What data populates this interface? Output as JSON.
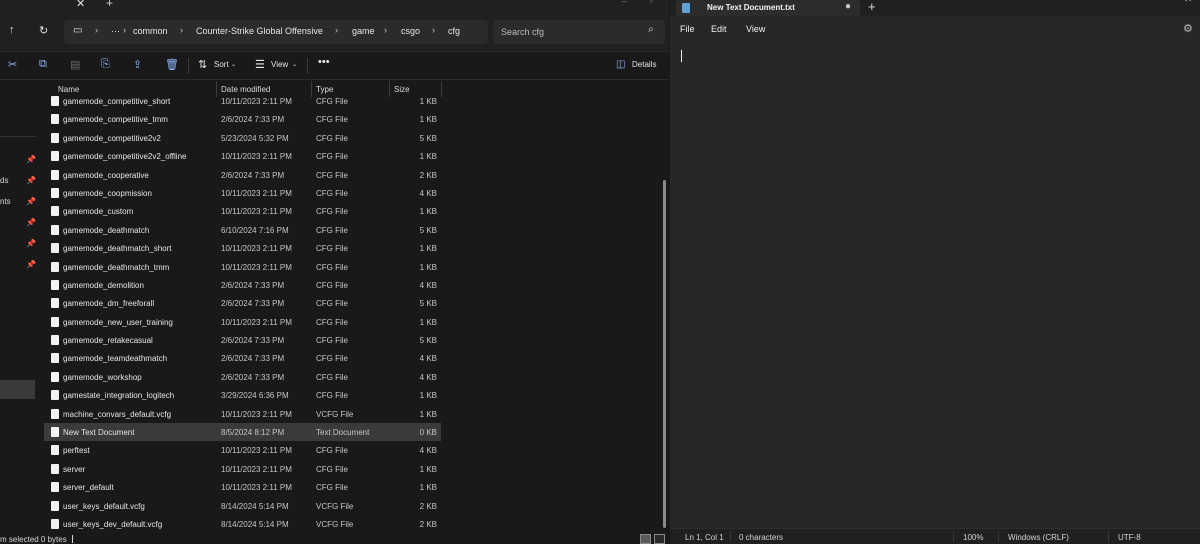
{
  "explorer": {
    "address": {
      "overflow": "···",
      "crumbs": [
        "common",
        "Counter-Strike Global Offensive",
        "game",
        "csgo",
        "cfg"
      ]
    },
    "search": {
      "placeholder": "Search cfg"
    },
    "toolbar": {
      "sort_label": "Sort",
      "view_label": "View",
      "details_label": "Details"
    },
    "nav_fragments": [
      "ds",
      "nts"
    ],
    "columns": {
      "name": "Name",
      "date": "Date modified",
      "type": "Type",
      "size": "Size"
    },
    "files": [
      {
        "name": "gamemode_competitive_short",
        "date": "10/11/2023 2:11 PM",
        "type": "CFG File",
        "size": "1 KB"
      },
      {
        "name": "gamemode_competitive_tmm",
        "date": "2/6/2024 7:33 PM",
        "type": "CFG File",
        "size": "1 KB"
      },
      {
        "name": "gamemode_competitive2v2",
        "date": "5/23/2024 5:32 PM",
        "type": "CFG File",
        "size": "5 KB"
      },
      {
        "name": "gamemode_competitive2v2_offline",
        "date": "10/11/2023 2:11 PM",
        "type": "CFG File",
        "size": "1 KB"
      },
      {
        "name": "gamemode_cooperative",
        "date": "2/6/2024 7:33 PM",
        "type": "CFG File",
        "size": "2 KB"
      },
      {
        "name": "gamemode_coopmission",
        "date": "10/11/2023 2:11 PM",
        "type": "CFG File",
        "size": "4 KB"
      },
      {
        "name": "gamemode_custom",
        "date": "10/11/2023 2:11 PM",
        "type": "CFG File",
        "size": "1 KB"
      },
      {
        "name": "gamemode_deathmatch",
        "date": "6/10/2024 7:16 PM",
        "type": "CFG File",
        "size": "5 KB"
      },
      {
        "name": "gamemode_deathmatch_short",
        "date": "10/11/2023 2:11 PM",
        "type": "CFG File",
        "size": "1 KB"
      },
      {
        "name": "gamemode_deathmatch_tmm",
        "date": "10/11/2023 2:11 PM",
        "type": "CFG File",
        "size": "1 KB"
      },
      {
        "name": "gamemode_demolition",
        "date": "2/6/2024 7:33 PM",
        "type": "CFG File",
        "size": "4 KB"
      },
      {
        "name": "gamemode_dm_freeforall",
        "date": "2/6/2024 7:33 PM",
        "type": "CFG File",
        "size": "5 KB"
      },
      {
        "name": "gamemode_new_user_training",
        "date": "10/11/2023 2:11 PM",
        "type": "CFG File",
        "size": "1 KB"
      },
      {
        "name": "gamemode_retakecasual",
        "date": "2/6/2024 7:33 PM",
        "type": "CFG File",
        "size": "5 KB"
      },
      {
        "name": "gamemode_teamdeathmatch",
        "date": "2/6/2024 7:33 PM",
        "type": "CFG File",
        "size": "4 KB"
      },
      {
        "name": "gamemode_workshop",
        "date": "2/6/2024 7:33 PM",
        "type": "CFG File",
        "size": "4 KB"
      },
      {
        "name": "gamestate_integration_logitech",
        "date": "3/29/2024 6:36 PM",
        "type": "CFG File",
        "size": "1 KB"
      },
      {
        "name": "machine_convars_default.vcfg",
        "date": "10/11/2023 2:11 PM",
        "type": "VCFG File",
        "size": "1 KB"
      },
      {
        "name": "New Text Document",
        "date": "8/5/2024 8:12 PM",
        "type": "Text Document",
        "size": "0 KB",
        "selected": true
      },
      {
        "name": "perftest",
        "date": "10/11/2023 2:11 PM",
        "type": "CFG File",
        "size": "4 KB"
      },
      {
        "name": "server",
        "date": "10/11/2023 2:11 PM",
        "type": "CFG File",
        "size": "1 KB"
      },
      {
        "name": "server_default",
        "date": "10/11/2023 2:11 PM",
        "type": "CFG File",
        "size": "1 KB"
      },
      {
        "name": "user_keys_default.vcfg",
        "date": "8/14/2024 5:14 PM",
        "type": "VCFG File",
        "size": "2 KB"
      },
      {
        "name": "user_keys_dev_default.vcfg",
        "date": "8/14/2024 5:14 PM",
        "type": "VCFG File",
        "size": "2 KB"
      }
    ],
    "status": {
      "text": "m selected  0 bytes"
    }
  },
  "notepad": {
    "tab_title": "New Text Document.txt",
    "modified_dot": "●",
    "menus": [
      "File",
      "Edit",
      "View"
    ],
    "content": "",
    "status": {
      "position": "Ln 1, Col 1",
      "characters": "0 characters",
      "zoom": "100%",
      "line_ending": "Windows (CRLF)",
      "encoding": "UTF-8"
    }
  }
}
